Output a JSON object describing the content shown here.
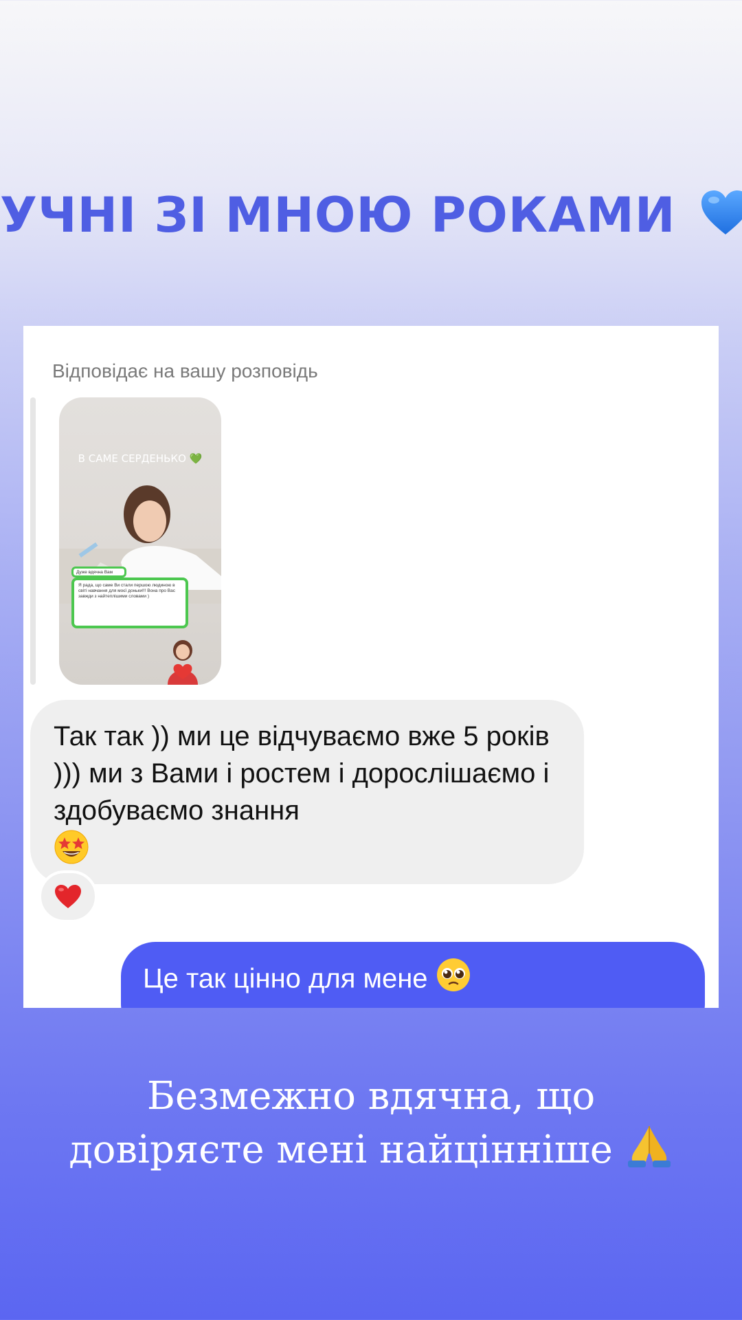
{
  "headline": {
    "text": "УЧНІ ЗІ МНОЮ РОКАМИ",
    "icon": "blue-heart-icon"
  },
  "card": {
    "reply_caption": "Відповідає на вашу розповідь",
    "story_thumbnail": {
      "title": "В САМЕ СЕРДЕНЬКО 💚",
      "chat_header": "Дуже вдячна Вам",
      "chat_text": "Я рада, що саме Ви стали першою людиною в світі навчання для моєї доньки!!! Вона про Вас завжди з найтеплішими словами )"
    },
    "incoming_message": {
      "text": "Так так )) ми це відчуваємо вже 5 років ))) ми з Вами і ростем і дорослішаємо і здобуваємо знання",
      "emoji": "star-struck-face-icon",
      "reaction": "red-heart-icon"
    },
    "outgoing_message": {
      "text": "Це так цінно для мене",
      "emoji": "pleading-face-icon"
    }
  },
  "footer": {
    "line1": "Безмежно вдячна, що",
    "line2": "довіряєте мені найцінніше",
    "emoji": "folded-hands-icon"
  },
  "colors": {
    "headline": "#4f5ee3",
    "outgoing_bubble": "#4f5cf4",
    "incoming_bubble": "#efefef",
    "background_bottom": "#5b66f1"
  }
}
